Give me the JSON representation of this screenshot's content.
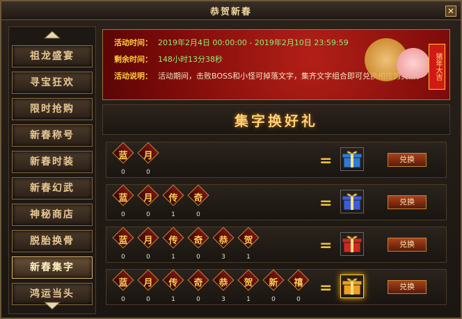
{
  "window": {
    "title": "恭贺新春",
    "close_glyph": "✕"
  },
  "sidebar": {
    "items": [
      {
        "label": "祖龙盛宴"
      },
      {
        "label": "寻宝狂欢"
      },
      {
        "label": "限时抢购"
      },
      {
        "label": "新春称号"
      },
      {
        "label": "新春时装"
      },
      {
        "label": "新春幻武"
      },
      {
        "label": "神秘商店"
      },
      {
        "label": "脱胎换骨"
      },
      {
        "label": "新春集字",
        "active": true
      },
      {
        "label": "鸿运当头"
      }
    ]
  },
  "banner": {
    "time_label": "活动时间：",
    "time_value": "2019年2月4日 00:00:00 - 2019年2月10日 23:59:59",
    "remain_label": "剩余时间：",
    "remain_value": "148小时13分38秒",
    "desc_label": "活动说明：",
    "desc_value": "活动期间，击败BOSS和小怪可掉落文字，集齐文字组合即可兑换相应的奖励。",
    "greeting": "猪年大吉"
  },
  "section": {
    "heading": "集字换好礼"
  },
  "rows": [
    {
      "chars": [
        {
          "c": "蓝",
          "n": "0"
        },
        {
          "c": "月",
          "n": "0"
        }
      ],
      "claim_label": "兑换",
      "gift_color": "#2e7ad8"
    },
    {
      "chars": [
        {
          "c": "蓝",
          "n": "0"
        },
        {
          "c": "月",
          "n": "0"
        },
        {
          "c": "传",
          "n": "1"
        },
        {
          "c": "奇",
          "n": "0"
        }
      ],
      "claim_label": "兑换",
      "gift_color": "#3a5ed8"
    },
    {
      "chars": [
        {
          "c": "蓝",
          "n": "0"
        },
        {
          "c": "月",
          "n": "0"
        },
        {
          "c": "传",
          "n": "1"
        },
        {
          "c": "奇",
          "n": "0"
        },
        {
          "c": "恭",
          "n": "3"
        },
        {
          "c": "贺",
          "n": "1"
        }
      ],
      "claim_label": "兑换",
      "gift_color": "#d02820"
    },
    {
      "chars": [
        {
          "c": "蓝",
          "n": "0"
        },
        {
          "c": "月",
          "n": "0"
        },
        {
          "c": "传",
          "n": "1"
        },
        {
          "c": "奇",
          "n": "0"
        },
        {
          "c": "恭",
          "n": "3"
        },
        {
          "c": "贺",
          "n": "1"
        },
        {
          "c": "新",
          "n": "0"
        },
        {
          "c": "禧",
          "n": "0"
        }
      ],
      "claim_label": "兑换",
      "gift_color": "#f0a020"
    }
  ]
}
